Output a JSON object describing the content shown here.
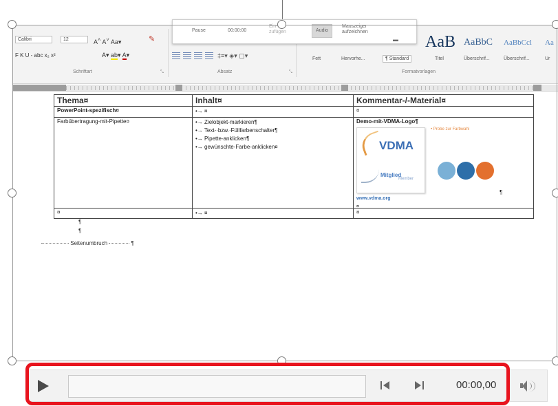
{
  "ribbon": {
    "font_name": "Calibri",
    "font_size": "12",
    "font_group_label": "Schriftart",
    "paragraph_group_label": "Absatz",
    "styles_group_label": "Formatvorlagen",
    "format_row": "F  K  U  -  abc  x₂  x²",
    "style_tags": [
      "Fett",
      "Hervorhe...",
      "¶ Standard"
    ],
    "styles": [
      {
        "sample": "AaB",
        "label": "Titel",
        "color": "#17365d"
      },
      {
        "sample": "AaBbC",
        "label": "Überschrif...",
        "color": "#365f91"
      },
      {
        "sample": "AaBbCcl",
        "label": "Überschrif...",
        "color": "#4f81bd"
      },
      {
        "sample": "Aa",
        "label": "Ur",
        "color": "#4f81bd"
      }
    ]
  },
  "recording": {
    "pause_label": "Pause",
    "time": "00:00:00",
    "button_left": "Ein-\nzufügen",
    "audio_label": "Audio",
    "pointer_label": "Mauszeiger aufzeichnen"
  },
  "table": {
    "headers": [
      "Thema¤",
      "Inhalt¤",
      "Kommentar-/-Material¤"
    ],
    "rows": [
      {
        "thema": "PowerPoint-spezifisch¤",
        "inhalt": [
          "•→ ¤"
        ],
        "kommentar": "¤",
        "bold_thema": true
      },
      {
        "thema": "Farbübertragung-mit-Pipette¤",
        "inhalt": [
          "•→ Zielobjekt-markieren¶",
          "•→ Text-·bzw.·Füllfarbenschalter¶",
          "•→ Pipette-anklicken¶",
          "•→ gewünschte-Farbe-anklicken¤"
        ],
        "kommentar": "Demo-mit-VDMA-Logo¶",
        "bold_thema": false
      },
      {
        "thema": "¤",
        "inhalt": [
          "•→ ¤"
        ],
        "kommentar": "¤",
        "bold_thema": false
      }
    ],
    "logo": {
      "name": "VDMA",
      "member_text": "Mitglied",
      "member_sub": "Member",
      "url": "www.vdma.org",
      "probe_text": "• Probe zur Farbwahl",
      "circle_colors": [
        "#7ab0d6",
        "#2e6fa9",
        "#e3702e"
      ],
      "para_mark": "¶",
      "cell_end": "¤"
    }
  },
  "after_table": {
    "para_marks": [
      "¶",
      "¶"
    ],
    "page_break": "Seitenumbruch"
  },
  "media": {
    "time": "00:00,00",
    "highlight_color": "#e8141e"
  }
}
